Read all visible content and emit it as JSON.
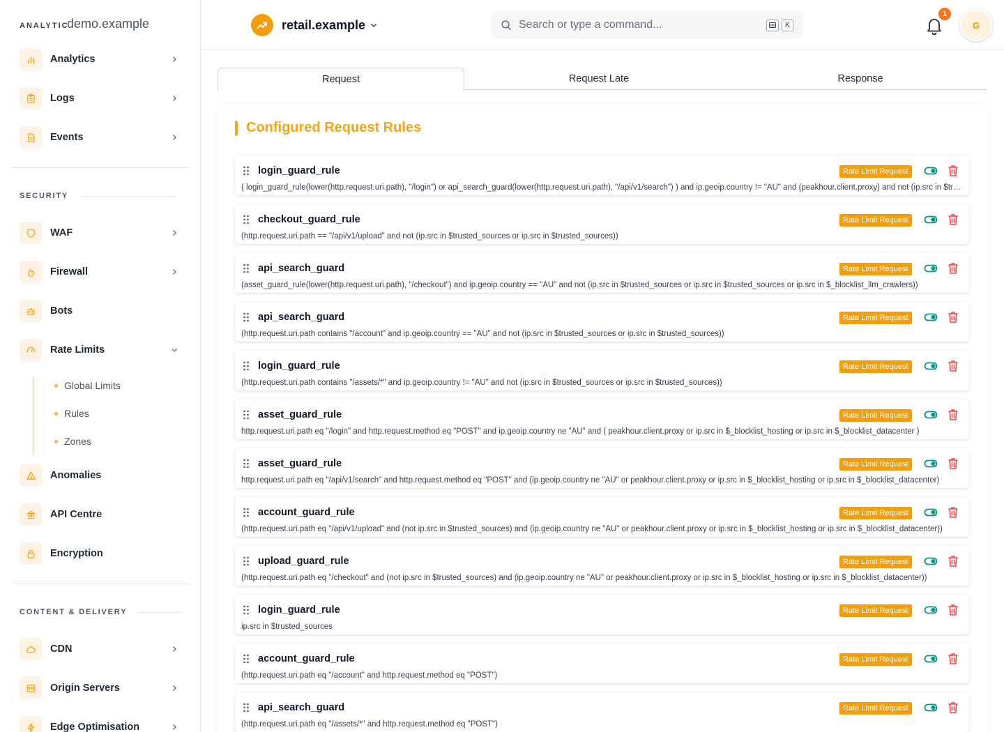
{
  "brand": {
    "short": "ANALYTICS",
    "domain": "demo.example"
  },
  "sidebar": {
    "top_items": [
      {
        "label": "Analytics",
        "icon": "bar-chart-icon"
      },
      {
        "label": "Logs",
        "icon": "clipboard-icon"
      },
      {
        "label": "Events",
        "icon": "document-icon"
      }
    ],
    "security_label": "SECURITY",
    "security_items": [
      {
        "label": "WAF",
        "icon": "shield-icon"
      },
      {
        "label": "Firewall",
        "icon": "flame-icon"
      },
      {
        "label": "Bots",
        "icon": "robot-icon"
      },
      {
        "label": "Rate Limits",
        "icon": "gauge-icon"
      }
    ],
    "rate_limits_sub": [
      "Global Limits",
      "Rules",
      "Zones"
    ],
    "security_items_2": [
      {
        "label": "Anomalies",
        "icon": "warning-icon"
      },
      {
        "label": "API Centre",
        "icon": "bank-icon"
      },
      {
        "label": "Encryption",
        "icon": "lock-icon"
      }
    ],
    "content_label": "CONTENT & DELIVERY",
    "content_items": [
      {
        "label": "CDN",
        "icon": "cloud-icon"
      },
      {
        "label": "Origin Servers",
        "icon": "server-icon"
      },
      {
        "label": "Edge Optimisation",
        "icon": "bolt-icon"
      }
    ]
  },
  "header": {
    "site_name": "retail.example",
    "search_placeholder": "Search or type a command...",
    "shortcut_key": "K",
    "notification_count": "1",
    "avatar_initial": "G"
  },
  "tabs": [
    "Request",
    "Request Late",
    "Response"
  ],
  "panel_title": "Configured Request Rules",
  "badge_label": "Rate Limit Request",
  "colors": {
    "accent": "#f5a516",
    "toggle": "#0d9488",
    "danger": "#ef4444"
  },
  "rules": [
    {
      "name": "login_guard_rule",
      "expr": "( login_guard_rule(lower(http.request.uri.path), \"/login\") or api_search_guard(lower(http.request.uri.path), \"/api/v1/search\") ) and ip.geoip.country != \"AU\" and (peakhour.client.proxy) and not (ip.src in $trusted_sources)"
    },
    {
      "name": "checkout_guard_rule",
      "expr": "(http.request.uri.path == \"/api/v1/upload\" and not (ip.src in $trusted_sources or ip.src in $trusted_sources))"
    },
    {
      "name": "api_search_guard",
      "expr": "(asset_guard_rule(lower(http.request.uri.path), \"/checkout\") and ip.geoip.country == \"AU\" and not (ip.src in $trusted_sources or ip.src in $trusted_sources or ip.src in $_blocklist_llm_crawlers))"
    },
    {
      "name": "api_search_guard",
      "expr": "(http.request.uri.path contains \"/account\" and ip.geoip.country == \"AU\" and not (ip.src in $trusted_sources or ip.src in $trusted_sources))"
    },
    {
      "name": "login_guard_rule",
      "expr": "(http.request.uri.path contains \"/assets/*\" and ip.geoip.country != \"AU\" and not (ip.src in $trusted_sources or ip.src in $trusted_sources))"
    },
    {
      "name": "asset_guard_rule",
      "expr": "http.request.uri.path eq \"/login\" and http.request.method eq \"POST\" and ip.geoip.country ne \"AU\" and ( peakhour.client.proxy or ip.src in $_blocklist_hosting or ip.src in $_blocklist_datacenter )"
    },
    {
      "name": "asset_guard_rule",
      "expr": "http.request.uri.path eq \"/api/v1/search\" and http.request.method eq \"POST\" and (ip.geoip.country ne \"AU\" or peakhour.client.proxy or ip.src in $_blocklist_hosting or ip.src in $_blocklist_datacenter)"
    },
    {
      "name": "account_guard_rule",
      "expr": "(http.request.uri.path eq \"/api/v1/upload\" and (not ip.src in $trusted_sources) and (ip.geoip.country ne \"AU\" or peakhour.client.proxy or ip.src in $_blocklist_hosting or ip.src in $_blocklist_datacenter))"
    },
    {
      "name": "upload_guard_rule",
      "expr": "(http.request.uri.path eq \"/checkout\" and (not ip.src in $trusted_sources) and (ip.geoip.country ne \"AU\" or peakhour.client.proxy or ip.src in $_blocklist_hosting or ip.src in $_blocklist_datacenter))"
    },
    {
      "name": "login_guard_rule",
      "expr": "ip.src in $trusted_sources"
    },
    {
      "name": "account_guard_rule",
      "expr": "(http.request.uri.path eq \"/account\" and http.request.method eq \"POST\")"
    },
    {
      "name": "api_search_guard",
      "expr": "(http.request.uri.path eq \"/assets/*\" and http.request.method eq \"POST\")"
    }
  ]
}
